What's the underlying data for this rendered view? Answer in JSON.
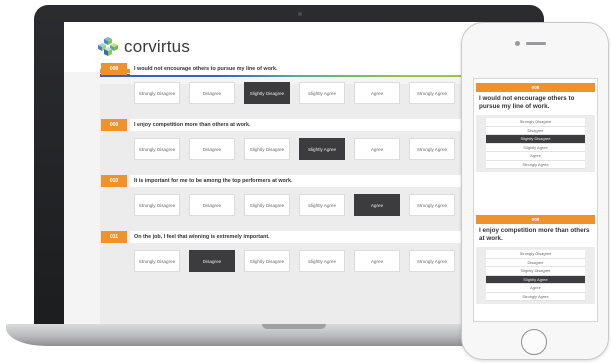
{
  "app": {
    "logo_text": "corvirtus",
    "logo_icon": "cube-cluster-icon",
    "progress": 0.62,
    "brand_orange": "#f0922b",
    "selected_color": "#3c3c3e"
  },
  "scale_options": [
    "Strongly Disagree",
    "Disagree",
    "Slightly Disagree",
    "Slightly Agree",
    "Agree",
    "Strongly Agree"
  ],
  "laptop_questions": [
    {
      "number": "008",
      "text": "I would not encourage others to pursue my line of work.",
      "selected": "Slightly Disagree"
    },
    {
      "number": "009",
      "text": "I enjoy competition more than others at work.",
      "selected": "Slightly Agree"
    },
    {
      "number": "010",
      "text": "It is important for me to be among the top performers at work.",
      "selected": "Agree"
    },
    {
      "number": "011",
      "text": "On the job, I feel that winning is extremely important.",
      "selected": "Disagree"
    }
  ],
  "phone_questions": [
    {
      "number": "008",
      "text": "I would not encourage others to pursue my line of work.",
      "selected": "Slightly Disagree"
    },
    {
      "number": "009",
      "text": "I enjoy competition more than others at work.",
      "selected": "Slightly Agree"
    }
  ]
}
